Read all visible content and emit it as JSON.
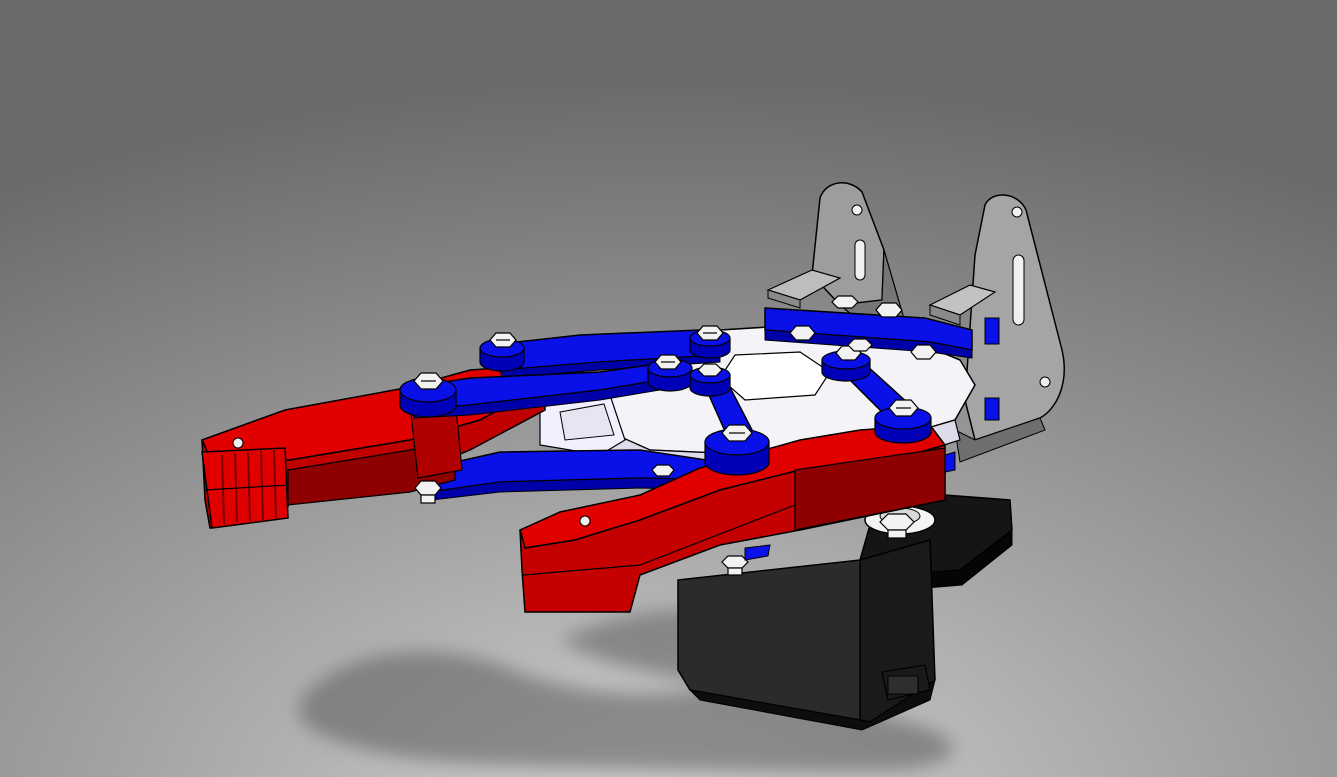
{
  "scene": {
    "kind": "cad-render",
    "colors": {
      "background_top": "#7a7a7a",
      "background_mid": "#9c9c9c",
      "background_bottom": "#cfcfcf",
      "shadow": "#5e5e5e",
      "red_part": "#e00000",
      "red_dark": "#a00000",
      "blue_part": "#0a10e8",
      "blue_dark": "#0000a8",
      "white_part": "#f4f4f8",
      "white_shade": "#cfcfe0",
      "gray_bracket": "#9a9a9a",
      "gray_bracket_dark": "#6e6e6e",
      "servo_body": "#2a2a2a",
      "servo_dark": "#111111",
      "bolt": "#f2f2f2",
      "edge": "#000000"
    },
    "parts": [
      "servo-motor",
      "servo-horn",
      "base-plate",
      "mounting-bracket-left",
      "mounting-bracket-right",
      "blue-cross-bar",
      "left-gripper-jaw",
      "right-gripper-jaw",
      "upper-linkage-arm",
      "middle-linkage-arm",
      "lower-linkage-arm",
      "short-linkage-arm",
      "diagonal-linkage-arm"
    ]
  }
}
